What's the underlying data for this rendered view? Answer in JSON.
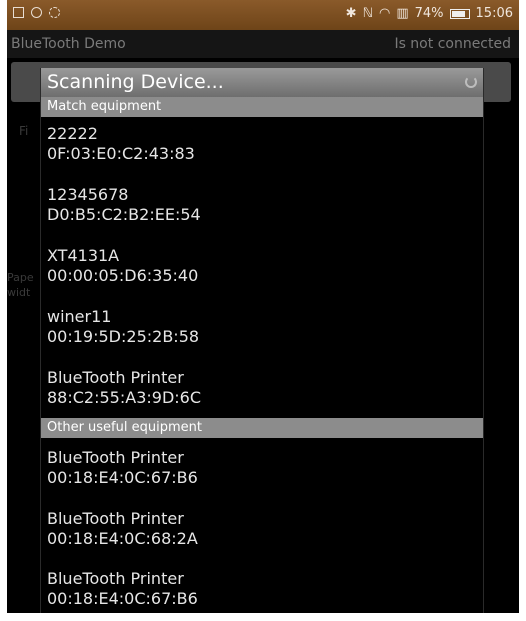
{
  "status_bar": {
    "battery_percent": "74%",
    "time": "15:06",
    "icons": [
      "gallery-icon",
      "circle-icon",
      "settings-icon",
      "bluetooth-icon",
      "nfc-icon",
      "wifi-icon",
      "data-icon",
      "battery-icon"
    ]
  },
  "app": {
    "title": "BlueTooth Demo",
    "connection_status": "Is not connected"
  },
  "background": {
    "label_fragment": "Fi",
    "side_text_1": "Pape",
    "side_text_2": "widt"
  },
  "dialog": {
    "title": "Scanning Device...",
    "match_section": "Match equipment",
    "match_devices": [
      {
        "name": "22222",
        "address": "0F:03:E0:C2:43:83"
      },
      {
        "name": "12345678",
        "address": "D0:B5:C2:B2:EE:54"
      },
      {
        "name": "XT4131A",
        "address": "00:00:05:D6:35:40"
      },
      {
        "name": "winer11",
        "address": "00:19:5D:25:2B:58"
      },
      {
        "name": "BlueTooth Printer",
        "address": "88:C2:55:A3:9D:6C"
      }
    ],
    "other_section": "Other useful equipment",
    "other_devices": [
      {
        "name": "BlueTooth Printer",
        "address": "00:18:E4:0C:67:B6"
      },
      {
        "name": "BlueTooth Printer",
        "address": "00:18:E4:0C:68:2A"
      },
      {
        "name": "BlueTooth Printer",
        "address": "00:18:E4:0C:67:B6"
      }
    ]
  },
  "colors": {
    "status_bar": "#7a4c20",
    "dialog_header": "#8a8a8a",
    "section_header": "#8c8c8c",
    "background": "#000000"
  }
}
